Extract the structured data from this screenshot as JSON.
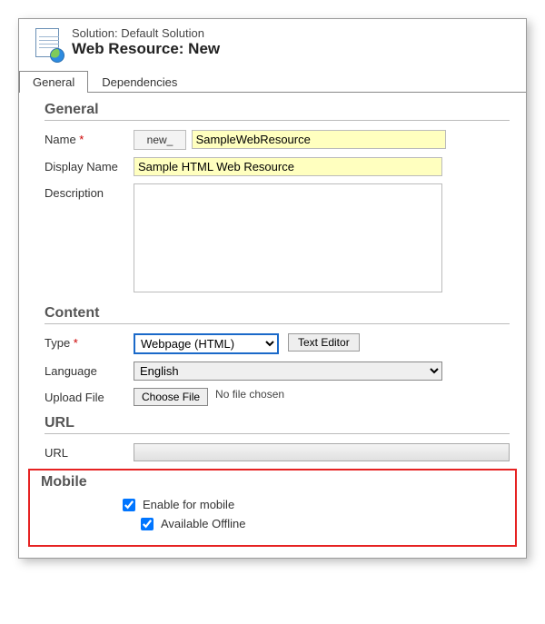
{
  "header": {
    "solution_line": "Solution: Default Solution",
    "title": "Web Resource: New"
  },
  "tabs": {
    "general": "General",
    "dependencies": "Dependencies"
  },
  "general": {
    "section": "General",
    "name_label": "Name",
    "name_prefix": "new_",
    "name_value": "SampleWebResource",
    "display_name_label": "Display Name",
    "display_name_value": "Sample HTML Web Resource",
    "description_label": "Description",
    "description_value": ""
  },
  "content": {
    "section": "Content",
    "type_label": "Type",
    "type_value": "Webpage (HTML)",
    "text_editor_btn": "Text Editor",
    "language_label": "Language",
    "language_value": "English",
    "upload_label": "Upload File",
    "choose_file_btn": "Choose File",
    "no_file_text": "No file chosen"
  },
  "url": {
    "section": "URL",
    "label": "URL",
    "value": ""
  },
  "mobile": {
    "section": "Mobile",
    "enable_label": "Enable for mobile",
    "offline_label": "Available Offline"
  }
}
